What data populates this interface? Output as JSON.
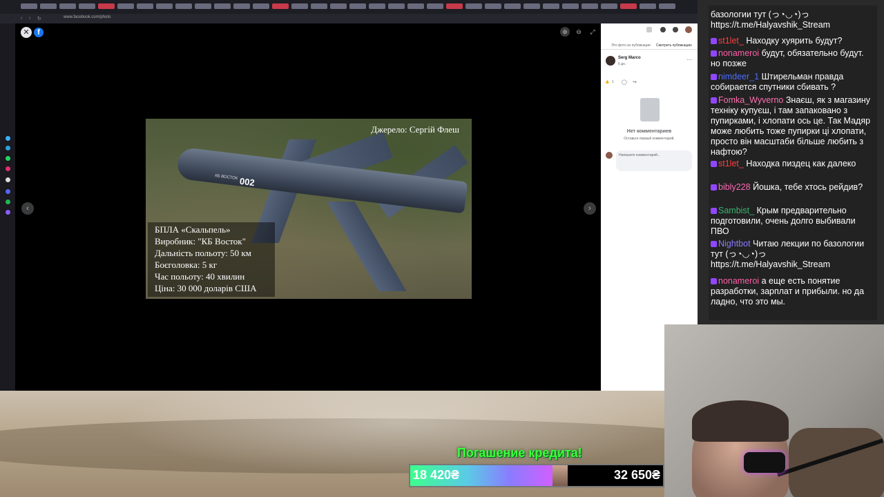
{
  "browser": {
    "url": "www.facebook.com/photo"
  },
  "viewer": {
    "close_icon": "close-icon",
    "logo_letter": "f"
  },
  "photo": {
    "source": "Джерело: Сергій Флеш",
    "registration": "002",
    "brand": "КБ ВОСТОК",
    "caption": [
      "БПЛА «Скальпель»",
      "Виробник: \"КБ Восток\"",
      "Дальність польоту: 50 км",
      "Боєголовка: 5 кг",
      "Час польоту: 40 хвилин",
      "Ціна: 30 000 доларів США"
    ]
  },
  "fbpanel": {
    "tabs": [
      "Это фото из публикации",
      "Смотреть публикацию"
    ],
    "author": "Serg Marco",
    "time": "6 дн. ·",
    "like_count": "1",
    "no_comments": "Нет комментариев",
    "be_first": "Оставьте первый комментарий.",
    "comment_placeholder": "Напишите комментарий..."
  },
  "chat": [
    {
      "user": "",
      "color": "#ffffff",
      "text": "базологии тут (っ◔◡◔)っ https://t.me/Halyavshik_Stream",
      "partial": true
    },
    {
      "user": "st1let_",
      "color": "#ff4040",
      "text": "Находку хуярить будут?"
    },
    {
      "user": "nonameroi",
      "color": "#ff5fa8",
      "text": "будут, обязательно будут. но позже"
    },
    {
      "user": "nimdeer_1",
      "color": "#4a6cff",
      "text": "Штирельман правда собирается спутники сбивать ?"
    },
    {
      "user": "Fomka_Wyverno",
      "color": "#ff6fb0",
      "text": "Знаєш, як з магазину техніку купуєш, і там запаковано з пупирками, і хлопати ось це. Так Мадяр може любить тоже пупирки ці хлопати, просто він масштаби більше любить з нафтою?"
    },
    {
      "user": "st1let_",
      "color": "#ff4040",
      "text": "Находка пиздец как далеко"
    },
    {
      "user": "bibly228",
      "color": "#ff69b4",
      "text": "Йошка, тебе хтось рейдив?"
    },
    {
      "user": "Sambist_",
      "color": "#3cb371",
      "text": "Крым предварительно подготовили, очень долго выбивали ПВО"
    },
    {
      "user": "Nightbot",
      "color": "#8a7cff",
      "text": "Читаю лекции по базологии тут (っ◔◡◔)っ https://t.me/Halyavshik_Stream"
    },
    {
      "user": "nonameroi",
      "color": "#ff5fa8",
      "text": "а еще есть понятие разработки, зарплат и прибыли. но да ладно, что это мы."
    }
  ],
  "donation": {
    "title": "Погашение кредита!",
    "current": "18 420₴",
    "goal": "32 650₴",
    "progress": 0.5642
  }
}
